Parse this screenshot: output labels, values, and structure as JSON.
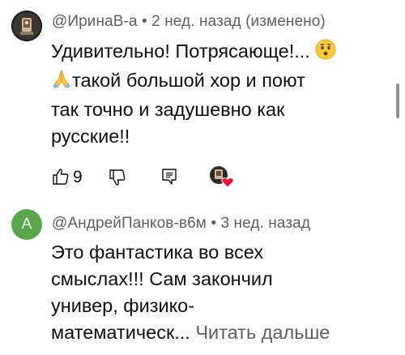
{
  "comments": [
    {
      "author": "@ИринаВ-а",
      "meta": " • 2 нед. назад (изменено)",
      "lines": [
        "Удивительно! Потрясающе!...",
        "такой большой хор и поют",
        "так точно и задушевно как",
        "русские!!"
      ],
      "emojis": [
        "hushed-face-emoji",
        "folded-hands-emoji"
      ],
      "likes": "9",
      "avatar": "ikon-avatar"
    },
    {
      "author": "@АндрейПанков-в6м",
      "meta": " • 3 нед. назад",
      "avatar_letter": "А",
      "avatar_color": "#5aa64a",
      "lines": [
        "Это фантастика во всех",
        "смыслах!!! Сам закончил",
        "универ, физико-",
        "математическ..."
      ],
      "read_more": "Читать дальше"
    }
  ],
  "icons": {
    "like": "thumbs-up-icon",
    "dislike": "thumbs-down-icon",
    "reply": "reply-icon",
    "heart": "creator-heart-icon"
  }
}
